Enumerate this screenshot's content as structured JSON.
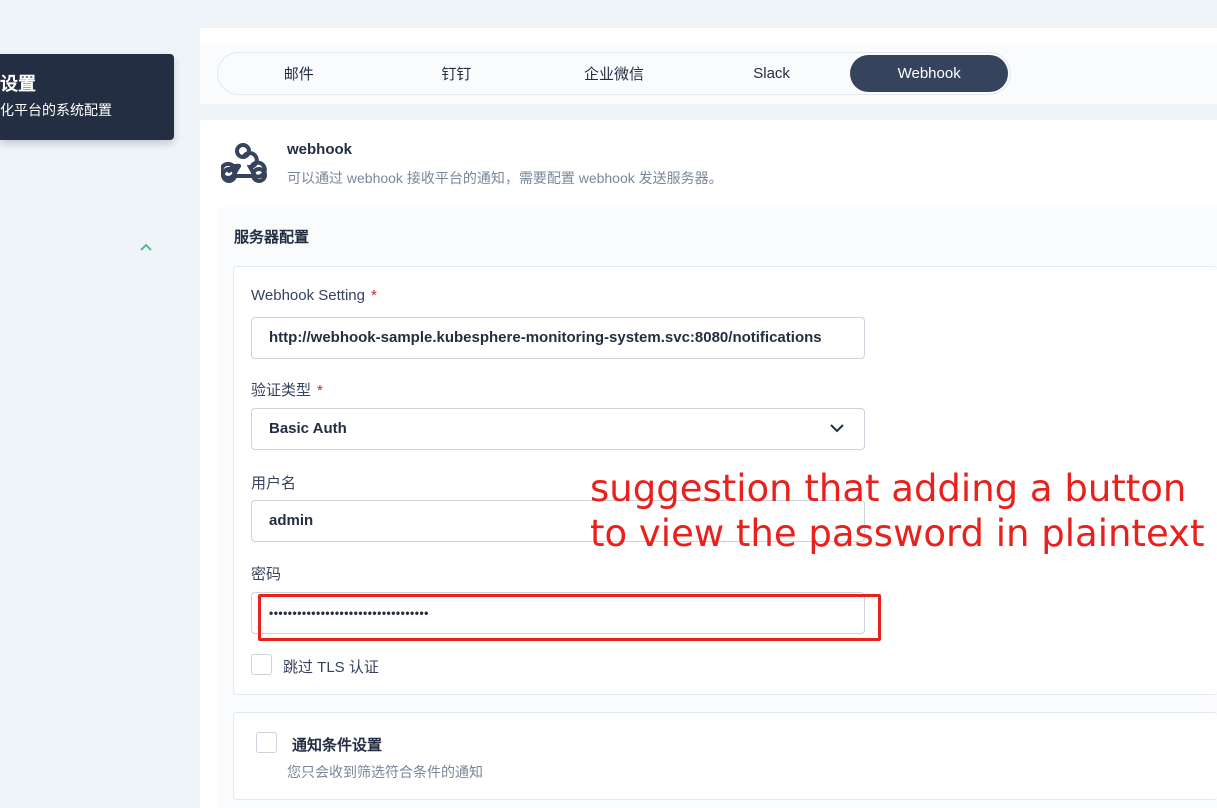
{
  "sidebar": {
    "title": "设置",
    "desc": "化平台的系统配置"
  },
  "tabs": [
    {
      "label": "邮件"
    },
    {
      "label": "钉钉"
    },
    {
      "label": "企业微信"
    },
    {
      "label": "Slack"
    },
    {
      "label": "Webhook",
      "active": true
    }
  ],
  "header": {
    "icon": "webhook-icon",
    "title": "webhook",
    "desc": "可以通过 webhook 接收平台的通知，需要配置 webhook 发送服务器。"
  },
  "server_config": {
    "title": "服务器配置",
    "webhook_setting_label": "Webhook Setting",
    "required_mark": "*",
    "webhook_url": "http://webhook-sample.kubesphere-monitoring-system.svc:8080/notifications",
    "auth_type_label": "验证类型",
    "auth_type_value": "Basic Auth",
    "username_label": "用户名",
    "username_value": "admin",
    "password_label": "密码",
    "password_value": "••••••••••••••••••••••••••••••••••",
    "skip_tls_label": "跳过 TLS 认证"
  },
  "notify_conditions": {
    "title": "通知条件设置",
    "desc": "您只会收到筛选符合条件的通知"
  },
  "annotation": {
    "text": "suggestion that adding a button to view the password in plaintext",
    "color": "#e8211d"
  },
  "colors": {
    "primary_dark": "#242e42",
    "active_tab": "#36435c",
    "accent_green": "#55bc8a",
    "required_red": "#ca2621"
  }
}
